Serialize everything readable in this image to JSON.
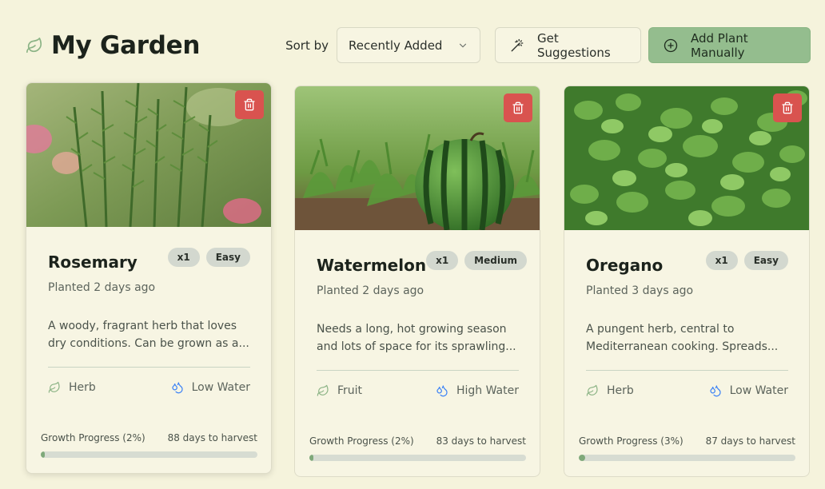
{
  "page": {
    "title": "My Garden"
  },
  "controls": {
    "sort_label": "Sort by",
    "sort_value": "Recently Added",
    "suggest_label": "Get Suggestions",
    "add_label": "Add Plant Manually"
  },
  "colors": {
    "background": "#f5f3dc",
    "accent": "#94bd8e",
    "delete": "#d9534f",
    "progress": "#7fa97a"
  },
  "plants": [
    {
      "name": "Rosemary",
      "quantity": "x1",
      "difficulty": "Easy",
      "planted": "Planted 2 days ago",
      "description": "A woody, fragrant herb that loves dry conditions. Can be grown as a...",
      "category": "Herb",
      "water": "Low Water",
      "progress_label": "Growth Progress (2%)",
      "progress": 0.02,
      "harvest": "88 days to harvest"
    },
    {
      "name": "Watermelon",
      "quantity": "x1",
      "difficulty": "Medium",
      "planted": "Planted 2 days ago",
      "description": "Needs a long, hot growing season and lots of space for its sprawling...",
      "category": "Fruit",
      "water": "High Water",
      "progress_label": "Growth Progress (2%)",
      "progress": 0.02,
      "harvest": "83 days to harvest"
    },
    {
      "name": "Oregano",
      "quantity": "x1",
      "difficulty": "Easy",
      "planted": "Planted 3 days ago",
      "description": "A pungent herb, central to Mediterranean cooking. Spreads...",
      "category": "Herb",
      "water": "Low Water",
      "progress_label": "Growth Progress (3%)",
      "progress": 0.03,
      "harvest": "87 days to harvest"
    }
  ]
}
